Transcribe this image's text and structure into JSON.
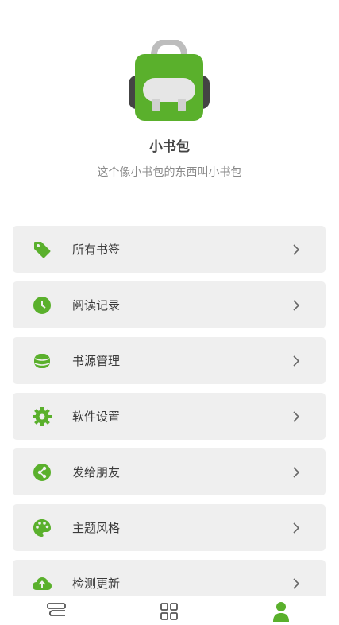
{
  "profile": {
    "name": "小书包",
    "slogan": "这个像小书包的东西叫小书包"
  },
  "menu": [
    {
      "label": "所有书签",
      "icon": "tag-icon"
    },
    {
      "label": "阅读记录",
      "icon": "clock-icon"
    },
    {
      "label": "书源管理",
      "icon": "database-icon"
    },
    {
      "label": "软件设置",
      "icon": "gear-icon"
    },
    {
      "label": "发给朋友",
      "icon": "share-icon"
    },
    {
      "label": "主题风格",
      "icon": "palette-icon"
    },
    {
      "label": "检测更新",
      "icon": "cloud-upload-icon"
    }
  ],
  "bottom_nav": {
    "tabs": [
      {
        "icon": "bookshelf-icon",
        "active": false
      },
      {
        "icon": "grid-icon",
        "active": false
      },
      {
        "icon": "person-icon",
        "active": true
      }
    ]
  },
  "colors": {
    "accent": "#5ab02c",
    "card_bg": "#efefef",
    "icon_inactive": "#555555"
  }
}
